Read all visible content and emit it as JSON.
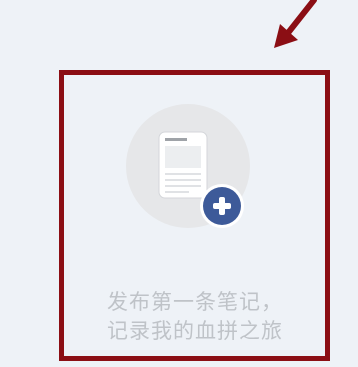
{
  "annotation": {
    "arrow_color": "#8b0e14",
    "frame_color": "#8b0e14",
    "arrow_icon": "arrow-down-left-icon"
  },
  "empty_state": {
    "icon": "new-note-icon",
    "icon_bg_color": "#e6e7e9",
    "document_color": "#ffffff",
    "plus_badge_color": "#3d5a99",
    "text_color": "#bfc3c8",
    "message_line1": "发布第一条笔记，",
    "message_line2": "记录我的血拼之旅"
  }
}
